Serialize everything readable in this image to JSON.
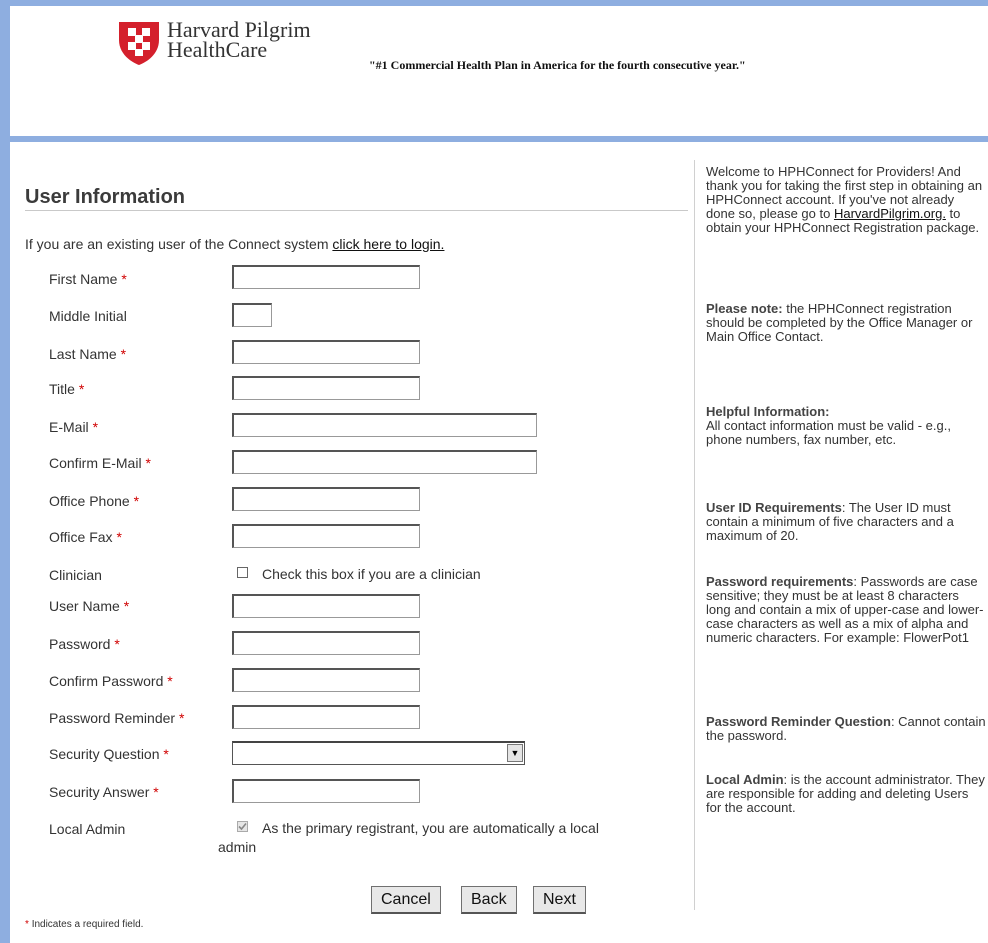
{
  "header": {
    "brand_line1": "Harvard Pilgrim",
    "brand_line2": "HealthCare",
    "tagline": "\"#1 Commercial Health Plan in America for the fourth consecutive year.\""
  },
  "form": {
    "title": "User Information",
    "intro_text": "If you are an existing user of the Connect system ",
    "login_link": "click here to login.",
    "fields": {
      "first_name": {
        "label": "First Name",
        "value": ""
      },
      "middle_initial": {
        "label": "Middle Initial",
        "value": ""
      },
      "last_name": {
        "label": "Last Name",
        "value": ""
      },
      "title": {
        "label": "Title",
        "value": ""
      },
      "email": {
        "label": "E-Mail",
        "value": ""
      },
      "confirm_email": {
        "label": "Confirm E-Mail",
        "value": ""
      },
      "office_phone": {
        "label": "Office Phone",
        "value": ""
      },
      "office_fax": {
        "label": "Office Fax",
        "value": ""
      },
      "clinician": {
        "label": "Clinician",
        "checkbox_text": "Check this box if you are a clinician",
        "checked": false
      },
      "user_name": {
        "label": "User Name",
        "value": ""
      },
      "password": {
        "label": "Password",
        "value": ""
      },
      "confirm_password": {
        "label": "Confirm Password",
        "value": ""
      },
      "password_reminder": {
        "label": "Password Reminder",
        "value": ""
      },
      "security_question": {
        "label": "Security Question",
        "selected": ""
      },
      "security_answer": {
        "label": "Security Answer",
        "value": ""
      },
      "local_admin": {
        "label": "Local Admin",
        "checkbox_text_line1": "As the primary registrant, you are automatically a local",
        "checkbox_text_line2": "admin",
        "checked": true
      }
    },
    "required_marker": "*",
    "buttons": {
      "cancel": "Cancel",
      "back": "Back",
      "next": "Next"
    },
    "required_note": "Indicates a required field."
  },
  "sidebar": {
    "welcome": "Welcome to HPHConnect for Providers! And thank you for taking the first step in obtaining an HPHConnect account. If you've not already done so, please go to",
    "welcome_link": "HarvardPilgrim.org.",
    "welcome_end": " to obtain your HPHConnect Registration package.",
    "note_heading": "Please note:",
    "note_text": " the HPHConnect registration should be completed by the Office Manager or Main Office Contact.",
    "helpful_heading": "Helpful Information:",
    "helpful_text": "All contact information must be valid - e.g., phone numbers, fax number, etc.",
    "userid_heading": "User ID Requirements",
    "userid_text": ": The User ID must contain a minimum of five characters and a maximum of 20.",
    "password_heading": "Password requirements",
    "password_text": ": Passwords are case sensitive; they must be at least 8 characters long and contain a mix of upper-case and lower-case characters as well as a mix of alpha and numeric characters. For example: FlowerPot1",
    "reminder_heading": "Password Reminder Question",
    "reminder_text": ": Cannot contain the password.",
    "admin_heading": "Local Admin",
    "admin_text": ": is the account administrator. They are responsible for adding and deleting Users for the account."
  },
  "colors": {
    "frame": "#8eaee0",
    "required": "#d00000",
    "logo_red": "#d4202c"
  }
}
